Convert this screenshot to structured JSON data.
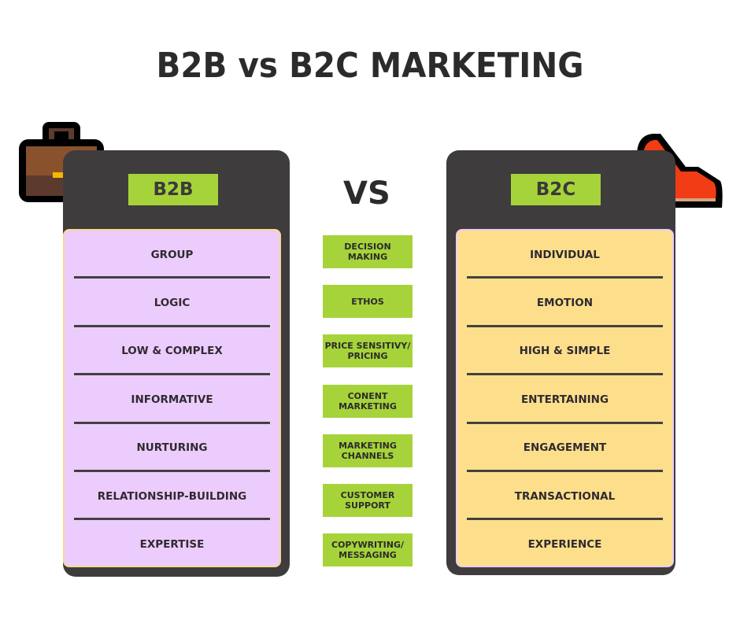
{
  "title": "B2B vs B2C MARKETING",
  "vs_label": "VS",
  "b2b": {
    "label": "B2B",
    "icon": "briefcase-icon",
    "items": [
      "GROUP",
      "LOGIC",
      "LOW & COMPLEX",
      "INFORMATIVE",
      "NURTURING",
      "RELATIONSHIP-BUILDING",
      "EXPERTISE"
    ]
  },
  "b2c": {
    "label": "B2C",
    "icon": "high-heel-shoe-icon",
    "items": [
      "INDIVIDUAL",
      "EMOTION",
      "HIGH & SIMPLE",
      "ENTERTAINING",
      "ENGAGEMENT",
      "TRANSACTIONAL",
      "EXPERIENCE"
    ]
  },
  "categories": [
    {
      "line1": "DECISION",
      "line2": "MAKING"
    },
    {
      "line1": "ETHOS",
      "line2": ""
    },
    {
      "line1": "PRICE SENSITIVY/",
      "line2": "PRICING"
    },
    {
      "line1": "CONENT",
      "line2": "MARKETING"
    },
    {
      "line1": "MARKETING",
      "line2": "CHANNELS"
    },
    {
      "line1": "CUSTOMER",
      "line2": "SUPPORT"
    },
    {
      "line1": "COPYWRITING/",
      "line2": "MESSAGING"
    }
  ],
  "colors": {
    "panel": "#3e3c3d",
    "green": "#a6d33a",
    "b2b_list": "#ecccfc",
    "b2c_list": "#fddf8b",
    "text": "#2b2b2b"
  }
}
